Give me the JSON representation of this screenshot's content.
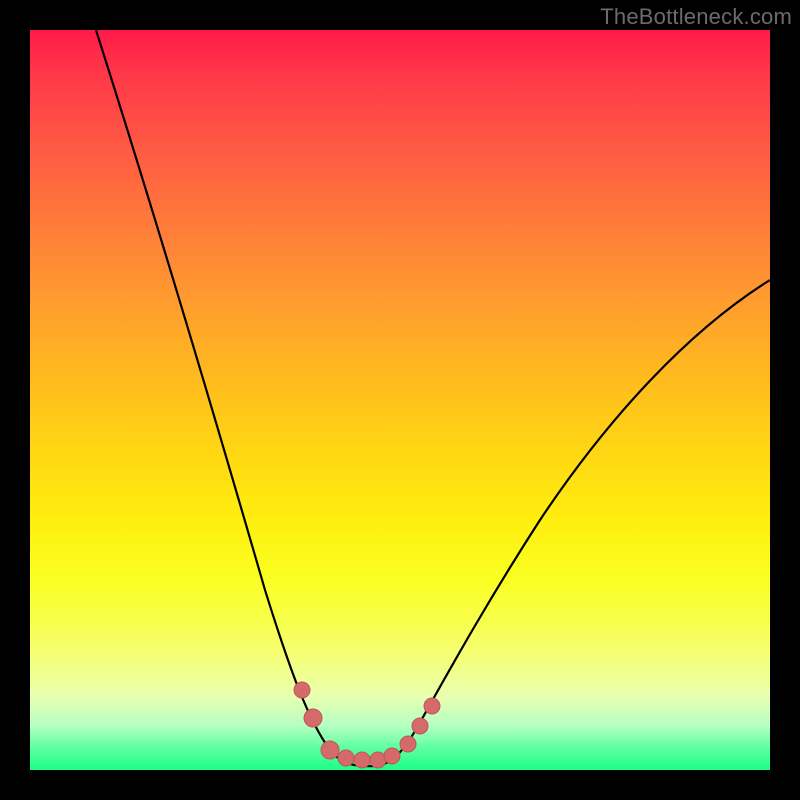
{
  "watermark": {
    "text": "TheBottleneck.com"
  },
  "colors": {
    "frame": "#000000",
    "curve_stroke": "#000000",
    "marker_fill": "#d46a6a",
    "marker_stroke": "#c05757",
    "gradient_stops": [
      "#ff1a49",
      "#ff3848",
      "#ff5a44",
      "#ff7a3a",
      "#ff9a30",
      "#ffb81f",
      "#ffd414",
      "#ffee0e",
      "#faff22",
      "#f7ff4c",
      "#f4ff7a",
      "#e9ffb0",
      "#b6ffc2",
      "#5effa0",
      "#1cff86"
    ]
  },
  "chart_data": {
    "type": "line",
    "title": "",
    "xlabel": "",
    "ylabel": "",
    "xlim": [
      0,
      100
    ],
    "ylim": [
      0,
      100
    ],
    "grid": false,
    "legend": false,
    "series": [
      {
        "name": "left-branch",
        "x": [
          9,
          12,
          15,
          18,
          21,
          24,
          27,
          30,
          32,
          34,
          36,
          38,
          40
        ],
        "y": [
          100,
          87,
          75,
          63,
          52,
          41,
          31,
          22,
          17,
          12,
          8,
          5,
          2
        ]
      },
      {
        "name": "valley-floor",
        "x": [
          40,
          42,
          44,
          46,
          48,
          50
        ],
        "y": [
          2,
          1,
          1,
          1,
          1,
          2
        ]
      },
      {
        "name": "right-branch",
        "x": [
          50,
          53,
          57,
          62,
          68,
          75,
          83,
          92,
          100
        ],
        "y": [
          2,
          6,
          12,
          20,
          29,
          39,
          49,
          58,
          66
        ]
      }
    ],
    "markers": {
      "name": "highlight-dots",
      "x": [
        37,
        38.5,
        41,
        43,
        45,
        47,
        49,
        51,
        52.5,
        54
      ],
      "y": [
        11,
        7,
        2.5,
        1.8,
        1.6,
        1.6,
        1.8,
        3.5,
        6,
        9
      ],
      "r": [
        8,
        9,
        9,
        8,
        8,
        8,
        8,
        8,
        8,
        8
      ]
    }
  }
}
